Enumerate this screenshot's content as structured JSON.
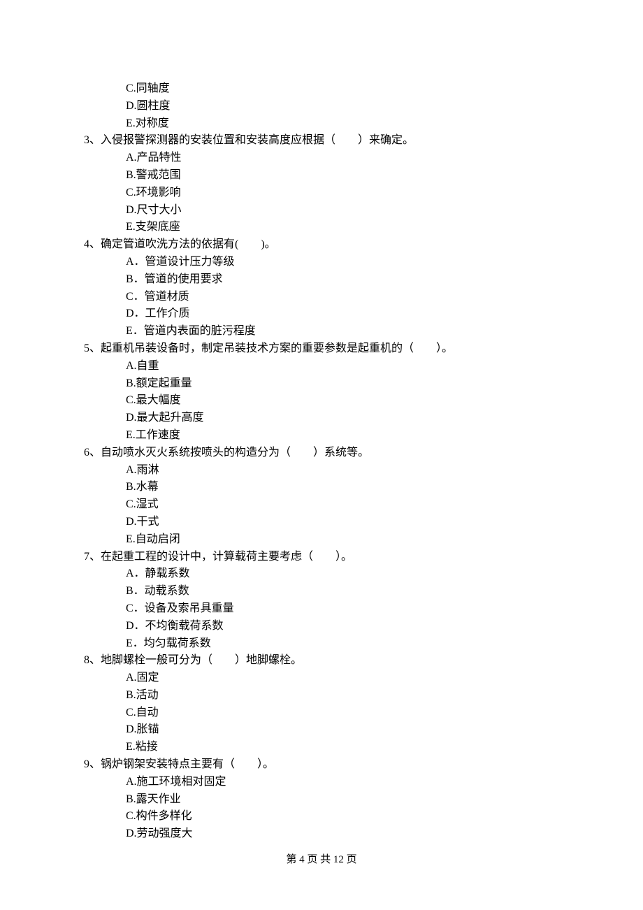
{
  "orphan_options": [
    "C.同轴度",
    "D.圆柱度",
    "E.对称度"
  ],
  "questions": [
    {
      "stem": "3、入侵报警探测器的安装位置和安装高度应根据（　　）来确定。",
      "options": [
        "A.产品特性",
        "B.警戒范围",
        "C.环境影响",
        "D.尺寸大小",
        "E.支架底座"
      ]
    },
    {
      "stem": "4、确定管道吹洗方法的依据有(　　)。",
      "options": [
        "A．管道设计压力等级",
        "B．管道的使用要求",
        "C．管道材质",
        "D．工作介质",
        "E．管道内表面的脏污程度"
      ]
    },
    {
      "stem": "5、起重机吊装设备时，制定吊装技术方案的重要参数是起重机的（　　）。",
      "options": [
        "A.自重",
        "B.额定起重量",
        "C.最大幅度",
        "D.最大起升高度",
        "E.工作速度"
      ]
    },
    {
      "stem": "6、自动喷水灭火系统按喷头的构造分为（　　）系统等。",
      "options": [
        "A.雨淋",
        "B.水幕",
        "C.湿式",
        "D.干式",
        "E.自动启闭"
      ]
    },
    {
      "stem": "7、在起重工程的设计中，计算载荷主要考虑（　　）。",
      "options": [
        "A．静载系数",
        "B．动载系数",
        "C．设备及索吊具重量",
        "D．不均衡载荷系数",
        "E．均匀载荷系数"
      ]
    },
    {
      "stem": "8、地脚螺栓一般可分为（　　）地脚螺栓。",
      "options": [
        "A.固定",
        "B.活动",
        "C.自动",
        "D.胀锚",
        "E.粘接"
      ]
    },
    {
      "stem": "9、锅炉钢架安装特点主要有（　　）。",
      "options": [
        "A.施工环境相对固定",
        "B.露天作业",
        "C.构件多样化",
        "D.劳动强度大"
      ]
    }
  ],
  "footer": "第 4 页 共 12 页"
}
